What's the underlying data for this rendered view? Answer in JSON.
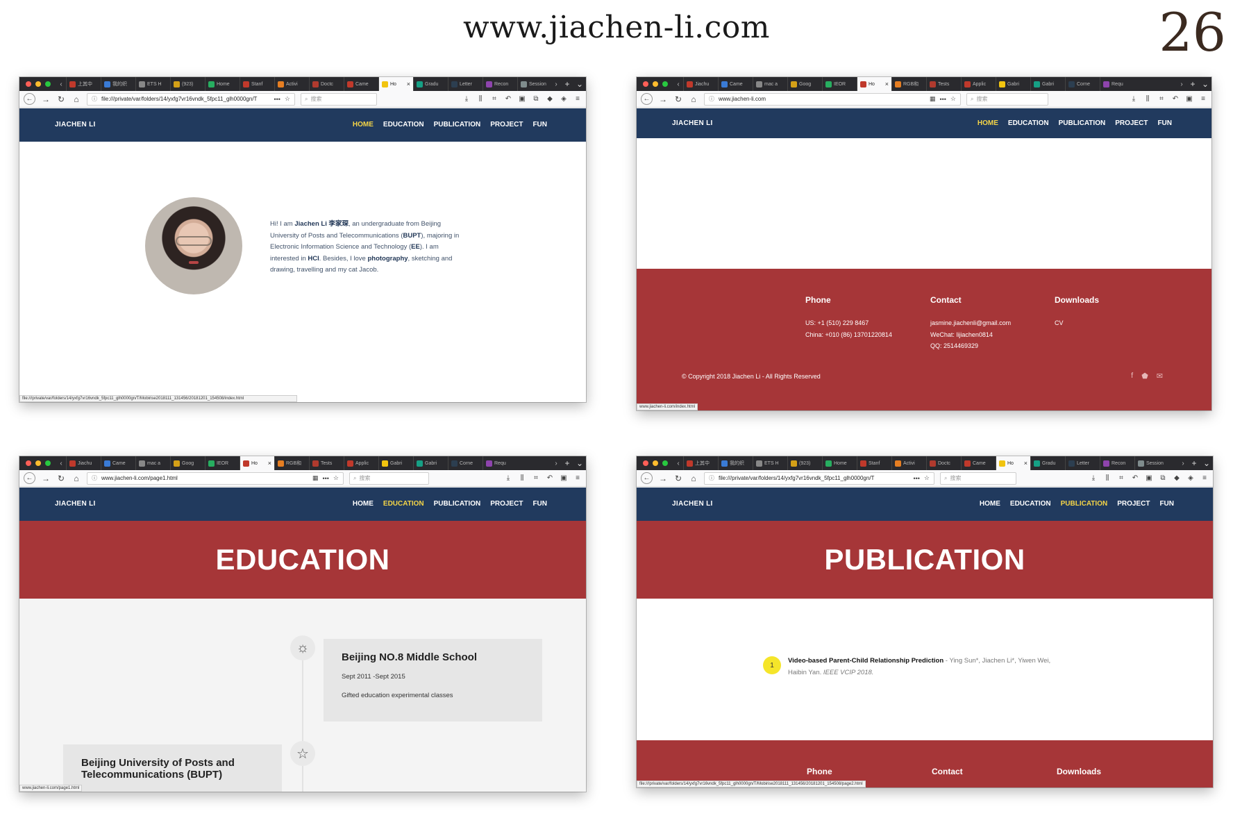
{
  "header": {
    "site_url": "www.jiachen-li.com",
    "page_number": "26"
  },
  "site": {
    "brand": "JIACHEN LI",
    "menu": [
      "HOME",
      "EDUCATION",
      "PUBLICATION",
      "PROJECT",
      "FUN"
    ]
  },
  "browser": {
    "search_placeholder": "搜索",
    "tab_sets": {
      "a": [
        "上其中",
        "我的织",
        "ETS H",
        "(923)",
        "Home",
        "Stanf",
        "Activi",
        "Doctc",
        "Came",
        "Ho",
        "Gradu",
        "Letter",
        "Recon",
        "Session"
      ],
      "b": [
        "Jiachu",
        "Came",
        "mac a",
        "Goog",
        "IEOR",
        "Ho",
        "RGB和",
        "Tests",
        "Applic",
        "Gabri",
        "Gabri",
        "Corne",
        "Requ"
      ]
    }
  },
  "colors": {
    "navy": "#213a5e",
    "red": "#a63638",
    "highlight": "#f5d547",
    "badge": "#f5e52a"
  },
  "windows": {
    "home": {
      "url": "file:///private/var/folders/14/yxfg7vr16vndk_5fpc11_glh0000gn/T",
      "status": "file:///private/var/folders/14/yxfg7vr16vndk_5fpc11_glh0000gn/T/Mobirise2018111_131456/20181201_154508/index.html",
      "bio": {
        "greeting": "Hi! I am ",
        "name": "Jiachen Li 李家琛",
        "part1": ", an undergraduate from Beijing University of Posts and Telecommunications (",
        "bupt": "BUPT",
        "part2": "), majoring in Electronic Information Science and Technology (",
        "ee": "EE",
        "part3": "). I am interested in ",
        "hci": "HCI",
        "part4": ". Besides, I love ",
        "photography": "photography",
        "part5": ", sketching and drawing, travelling and my cat Jacob."
      }
    },
    "contact": {
      "url": "www.jiachen-li.com",
      "status": "www.jiachen-li.com/index.html",
      "phone": {
        "heading": "Phone",
        "lines": [
          "US: +1 (510) 229 8467",
          "China: +010 (86) 13701220814"
        ]
      },
      "contact": {
        "heading": "Contact",
        "lines": [
          "jasmine.jiachenli@gmail.com",
          "WeChat: lijiachen0814",
          "QQ: 2514469329"
        ]
      },
      "downloads": {
        "heading": "Downloads",
        "lines": [
          "CV"
        ]
      },
      "copyright": "© Copyright 2018 Jiachen Li - All Rights Reserved"
    },
    "education": {
      "url": "www.jiachen-li.com/page1.html",
      "status": "www.jiachen-li.com/page1.html",
      "title": "EDUCATION",
      "card1": {
        "school": "Beijing NO.8 Middle School",
        "dates": "Sept 2011 -Sept 2015",
        "note": "Gifted education experimental classes"
      },
      "card2": {
        "school": "Beijing University of Posts and Telecommunications (BUPT)"
      }
    },
    "publication": {
      "url": "file:///private/var/folders/14/yxfg7vr16vndk_5fpc11_glh0000gn/T",
      "status": "file:///private/var/folders/14/yxfg7vr16vndk_5fpc11_glh0000gn/T/Mobirise2018111_131456/20181201_154508/page2.html",
      "title": "PUBLICATION",
      "entry": {
        "number": "1",
        "title": "Video-based Parent-Child Relationship Prediction",
        "authors": " - Ying Sun*, Jiachen Li*, Yiwen Wei, Haibin Yan. ",
        "venue": "IEEE VCIP 2018."
      },
      "footer": [
        "Phone",
        "Contact",
        "Downloads"
      ]
    }
  }
}
